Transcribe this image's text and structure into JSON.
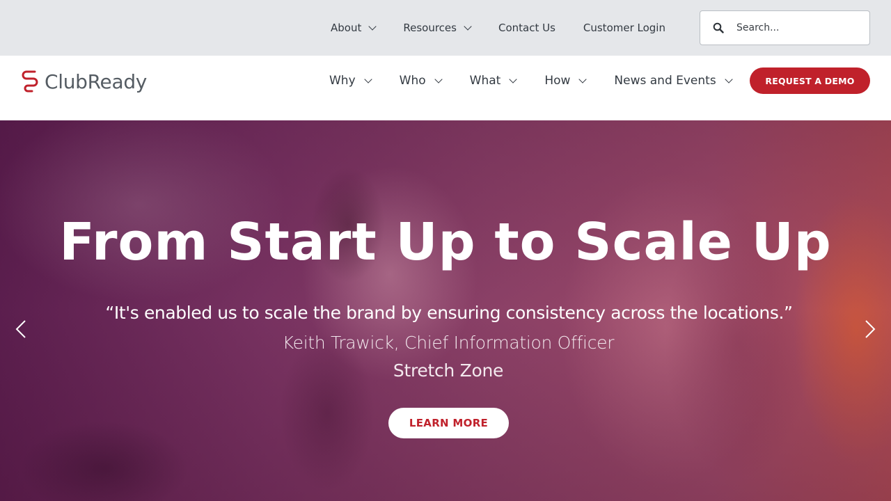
{
  "utility_nav": {
    "items": [
      {
        "label": "About",
        "dropdown": true
      },
      {
        "label": "Resources",
        "dropdown": true
      },
      {
        "label": "Contact Us",
        "dropdown": false
      },
      {
        "label": "Customer Login",
        "dropdown": false
      }
    ],
    "search": {
      "placeholder": "Search...",
      "value": "",
      "icon": "search-icon"
    }
  },
  "header": {
    "logo_text": "ClubReady",
    "nav": [
      {
        "label": "Why",
        "dropdown": true
      },
      {
        "label": "Who",
        "dropdown": true
      },
      {
        "label": "What",
        "dropdown": true
      },
      {
        "label": "How",
        "dropdown": true
      },
      {
        "label": "News and Events",
        "dropdown": true
      }
    ],
    "cta_label": "REQUEST A DEMO"
  },
  "hero": {
    "title": "From Start Up to Scale Up",
    "quote": "“It's enabled us to scale the brand by ensuring consistency across the locations.”",
    "author": "Keith Trawick, Chief Information Officer",
    "company": "Stretch Zone",
    "cta_label": "LEARN MORE"
  },
  "colors": {
    "brand_red": "#c0212b",
    "utility_bar_bg": "#e5e7ea",
    "text_dark": "#333a42",
    "hero_overlay": "#7a3463"
  }
}
